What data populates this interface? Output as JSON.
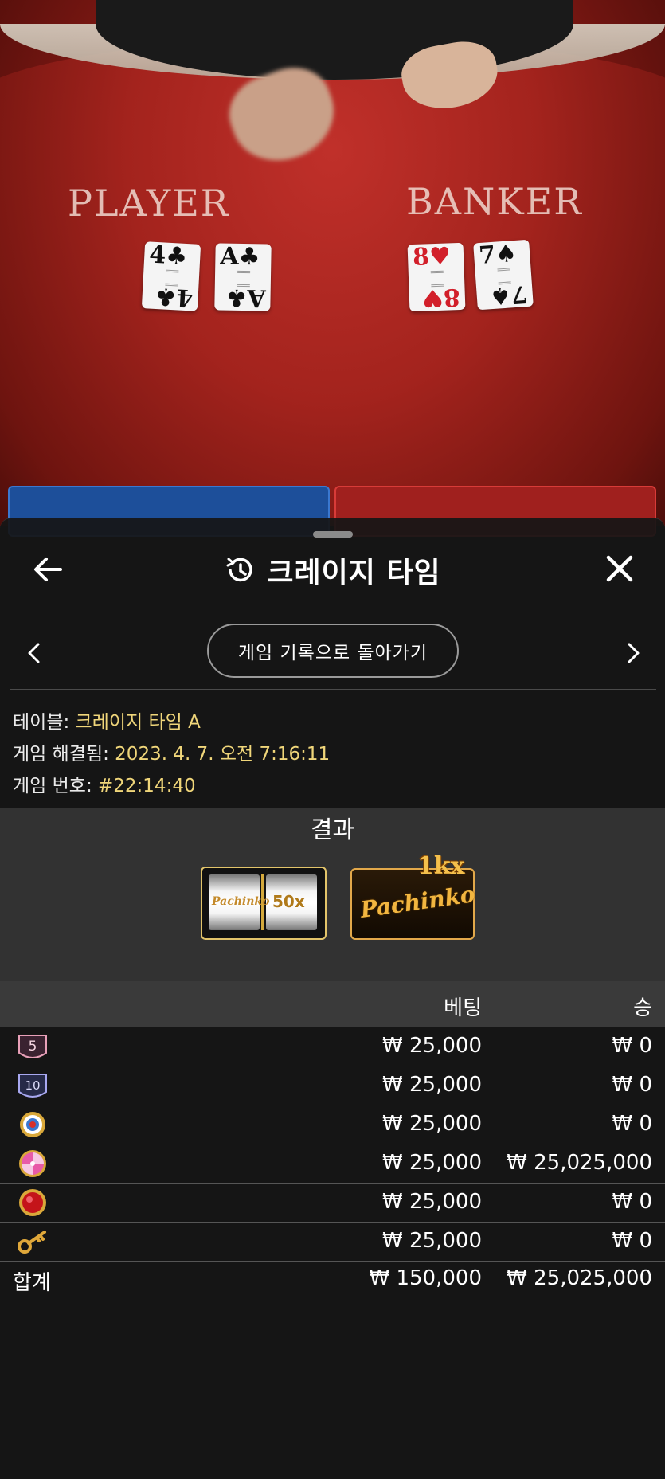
{
  "background": {
    "player_label": "PLAYER",
    "banker_label": "BANKER",
    "player_cards": [
      {
        "rank": "4",
        "suit": "♣",
        "color": "black"
      },
      {
        "rank": "A",
        "suit": "♣",
        "color": "black"
      }
    ],
    "banker_cards": [
      {
        "rank": "8",
        "suit": "♥",
        "color": "red"
      },
      {
        "rank": "7",
        "suit": "♠",
        "color": "black"
      }
    ]
  },
  "header": {
    "title": "크레이지 타임",
    "back_icon": "arrow-left-icon",
    "history_icon": "history-icon",
    "close_icon": "close-icon"
  },
  "navigation": {
    "back_to_history_label": "게임 기록으로 돌아가기",
    "prev_icon": "chevron-left-icon",
    "next_icon": "chevron-right-icon"
  },
  "info": {
    "table_label": "테이블: ",
    "table_value": "크레이지 타임 A",
    "resolved_label": "게임 해결됨: ",
    "resolved_value": "2023. 4. 7. 오전 7:16:11",
    "number_label": "게임 번호: ",
    "number_value": "#22:14:40"
  },
  "result": {
    "title": "결과",
    "slot": {
      "left_text": "Pachinko",
      "right_text": "50x"
    },
    "bonus": {
      "name": "Pachinko",
      "multiplier": "1kx"
    }
  },
  "bets_table": {
    "col_bet": "베팅",
    "col_win": "승",
    "rows": [
      {
        "icon": "number-5-icon",
        "icon_text": "5",
        "bet": "₩ 25,000",
        "win": "₩ 0"
      },
      {
        "icon": "number-10-icon",
        "icon_text": "10",
        "bet": "₩ 25,000",
        "win": "₩ 0"
      },
      {
        "icon": "coin-flip-icon",
        "icon_text": "",
        "bet": "₩ 25,000",
        "win": "₩ 0"
      },
      {
        "icon": "pachinko-icon",
        "icon_text": "",
        "bet": "₩ 25,000",
        "win": "₩ 25,025,000"
      },
      {
        "icon": "crazy-time-icon",
        "icon_text": "",
        "bet": "₩ 25,000",
        "win": "₩ 0"
      },
      {
        "icon": "cash-hunt-key-icon",
        "icon_text": "",
        "bet": "₩ 25,000",
        "win": "₩ 0"
      }
    ],
    "total_label": "합계",
    "total_bet": "₩ 150,000",
    "total_win": "₩ 25,025,000"
  },
  "colors": {
    "accent_value": "#f0d67a",
    "sheet_bg": "#161616",
    "table_red": "#a3231d"
  }
}
